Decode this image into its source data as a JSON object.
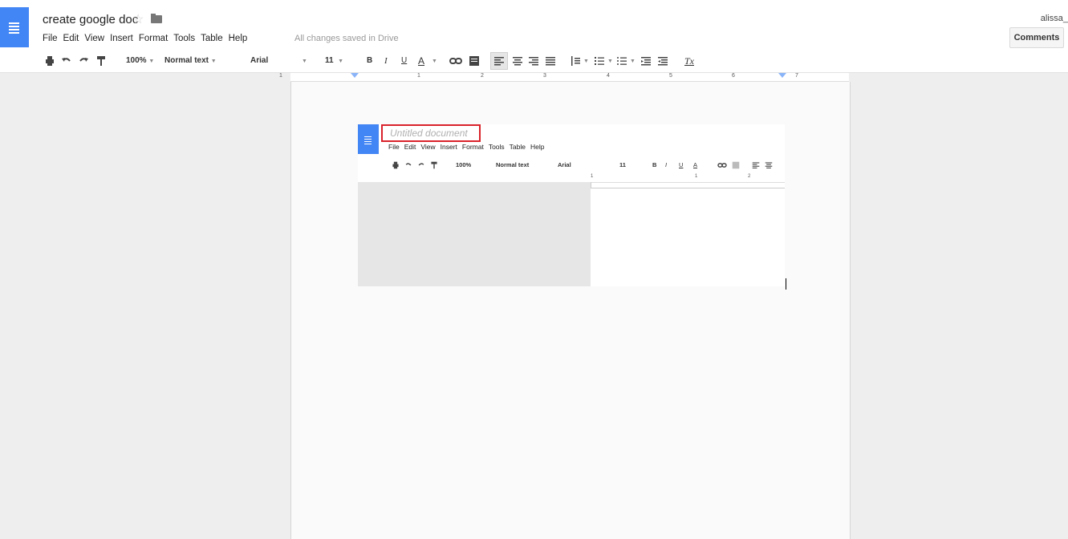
{
  "app": {
    "doc_title": "create google doc",
    "user": "alissa_",
    "saved_status": "All changes saved in Drive",
    "comments_label": "Comments",
    "accent": "#4285f4"
  },
  "menu": [
    "File",
    "Edit",
    "View",
    "Insert",
    "Format",
    "Tools",
    "Table",
    "Help"
  ],
  "toolbar": {
    "zoom": "100%",
    "style": "Normal text",
    "font": "Arial",
    "size": "11",
    "bold": "B",
    "italic": "I",
    "underline": "U",
    "text_color": "A",
    "clear_format": "Tx"
  },
  "ruler": {
    "labels": [
      "1",
      "1",
      "2",
      "3",
      "4",
      "5",
      "6",
      "7"
    ]
  },
  "embedded_screenshot": {
    "doc_title": "Untitled document",
    "menu": [
      "File",
      "Edit",
      "View",
      "Insert",
      "Format",
      "Tools",
      "Table",
      "Help"
    ],
    "toolbar": {
      "zoom": "100%",
      "style": "Normal text",
      "font": "Arial",
      "size": "11",
      "bold": "B",
      "italic": "I",
      "underline": "U",
      "text_color": "A"
    },
    "ruler_labels": [
      "1",
      "1",
      "2"
    ],
    "highlight_color": "#d9222b"
  },
  "icons": [
    "docs-logo-icon",
    "star-icon",
    "folder-icon",
    "print-icon",
    "undo-icon",
    "redo-icon",
    "paint-format-icon",
    "link-icon",
    "comment-icon",
    "align-left-icon",
    "align-center-icon",
    "align-right-icon",
    "justify-icon",
    "line-spacing-icon",
    "numbered-list-icon",
    "bulleted-list-icon",
    "decrease-indent-icon",
    "increase-indent-icon",
    "clear-format-icon"
  ]
}
